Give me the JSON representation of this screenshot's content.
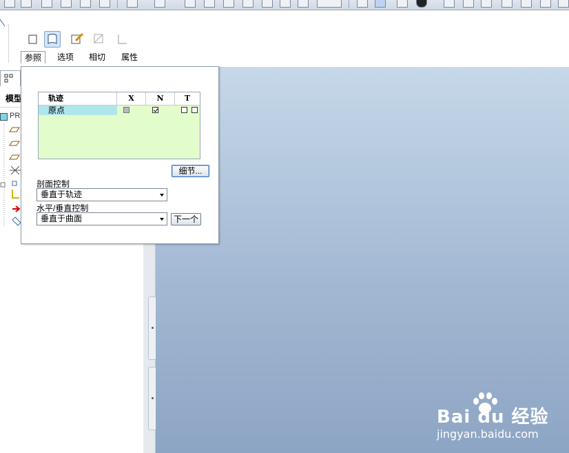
{
  "colors": {
    "canvas_top": "#c6d8e9",
    "canvas_bottom": "#8da5c4",
    "table_bg": "#e2fccb",
    "selected_row": "#aee6ea",
    "accent": "#3b6fb6"
  },
  "dashboard": {
    "tabs": [
      {
        "label": "参照",
        "active": true
      },
      {
        "label": "选项",
        "active": false
      },
      {
        "label": "相切",
        "active": false
      },
      {
        "label": "属性",
        "active": false
      }
    ],
    "icons": [
      "solid-icon",
      "surface-icon",
      "sketch-icon",
      "remove-material-icon",
      "thicken-icon"
    ]
  },
  "model_tree": {
    "tab_label": "模型",
    "root_label": "PR"
  },
  "ref_panel": {
    "table": {
      "headers": [
        "轨迹",
        "X",
        "N",
        "T"
      ],
      "rows": [
        {
          "name": "原点",
          "x": "unchecked-gray",
          "n": "checked",
          "t": "unchecked"
        }
      ]
    },
    "details_button": "细节...",
    "section_control_label": "剖面控制",
    "section_control_value": "垂直于轨迹",
    "hv_control_label": "水平/垂直控制",
    "hv_control_value": "垂直于曲面",
    "next_button": "下一个"
  },
  "watermark": {
    "brand_line": "Bai du 经验",
    "url": "jingyan.baidu.com"
  }
}
